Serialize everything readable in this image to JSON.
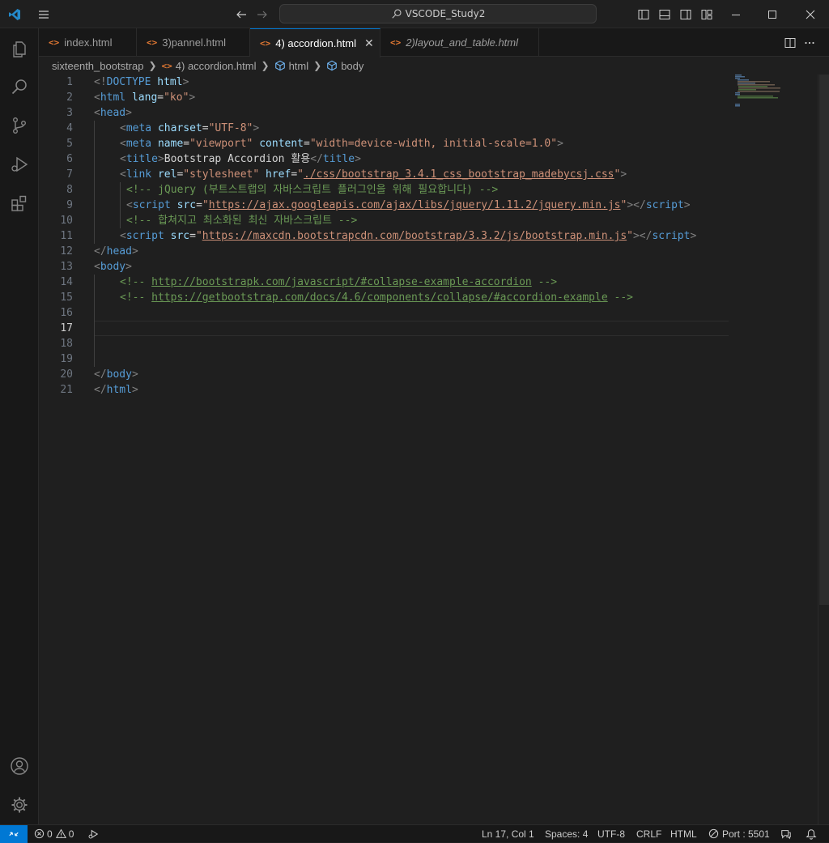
{
  "window": {
    "search_label": "VSCODE_Study2"
  },
  "tabs": [
    {
      "icon": "html-file-icon",
      "label": "index.html",
      "active": false,
      "italic": false
    },
    {
      "icon": "html-file-icon",
      "label": "3)pannel.html",
      "active": false,
      "italic": false
    },
    {
      "icon": "html-file-icon",
      "label": "4) accordion.html",
      "active": true,
      "italic": false
    },
    {
      "icon": "html-file-icon",
      "label": "2)layout_and_table.html",
      "active": false,
      "italic": true
    }
  ],
  "breadcrumb": {
    "folder": "sixteenth_bootstrap",
    "file": "4) accordion.html",
    "html": "html",
    "body": "body"
  },
  "line_numbers": [
    "1",
    "2",
    "3",
    "4",
    "5",
    "6",
    "7",
    "8",
    "9",
    "10",
    "11",
    "12",
    "13",
    "14",
    "15",
    "16",
    "17",
    "18",
    "19",
    "20",
    "21"
  ],
  "current_line": 17,
  "code": {
    "l1": [
      "<!",
      "DOCTYPE",
      " ",
      "html",
      ">"
    ],
    "l2": [
      "<",
      "html",
      " ",
      "lang",
      "=",
      "\"ko\"",
      ">"
    ],
    "l3": [
      "<",
      "head",
      ">"
    ],
    "l4": [
      "<",
      "meta",
      " ",
      "charset",
      "=",
      "\"UTF-8\"",
      ">"
    ],
    "l5": [
      "<",
      "meta",
      " ",
      "name",
      "=",
      "\"viewport\"",
      " ",
      "content",
      "=",
      "\"width=device-width, initial-scale=1.0\"",
      ">"
    ],
    "l6": [
      "<",
      "title",
      ">",
      "Bootstrap Accordion 활용",
      "</",
      "title",
      ">"
    ],
    "l7": [
      "<",
      "link",
      " ",
      "rel",
      "=",
      "\"stylesheet\"",
      " ",
      "href",
      "=",
      "\"",
      "./css/bootstrap_3.4.1_css_bootstrap_madebycsj.css",
      "\"",
      ">"
    ],
    "l8": "<!-- jQuery (부트스트랩의 자바스크립트 플러그인을 위해 필요합니다) -->",
    "l9": [
      "<",
      "script",
      " ",
      "src",
      "=",
      "\"",
      "https://ajax.googleapis.com/ajax/libs/jquery/1.11.2/jquery.min.js",
      "\"",
      "></",
      "script",
      ">"
    ],
    "l10": "<!-- 합쳐지고 최소화된 최신 자바스크립트 -->",
    "l11": [
      "<",
      "script",
      " ",
      "src",
      "=",
      "\"",
      "https://maxcdn.bootstrapcdn.com/bootstrap/3.3.2/js/bootstrap.min.js",
      "\"",
      "></",
      "script",
      ">"
    ],
    "l12": [
      "</",
      "head",
      ">"
    ],
    "l13": [
      "<",
      "body",
      ">"
    ],
    "l14": [
      "<!-- ",
      "http://bootstrapk.com/javascript/#collapse-example-accordion",
      " -->"
    ],
    "l15": [
      "<!-- ",
      "https://getbootstrap.com/docs/4.6/components/collapse/#accordion-example",
      " -->"
    ],
    "l20": [
      "</",
      "body",
      ">"
    ],
    "l21": [
      "</",
      "html",
      ">"
    ]
  },
  "status": {
    "errors": "0",
    "warnings": "0",
    "position": "Ln 17, Col 1",
    "spaces": "Spaces: 4",
    "encoding": "UTF-8",
    "eol": "CRLF",
    "language": "HTML",
    "port": "Port : 5501"
  },
  "colors": {
    "accent": "#0078d4",
    "tag": "#569cd6",
    "attribute": "#9cdcfe",
    "string": "#ce9178",
    "comment": "#6a9955",
    "html_icon": "#e37933"
  }
}
